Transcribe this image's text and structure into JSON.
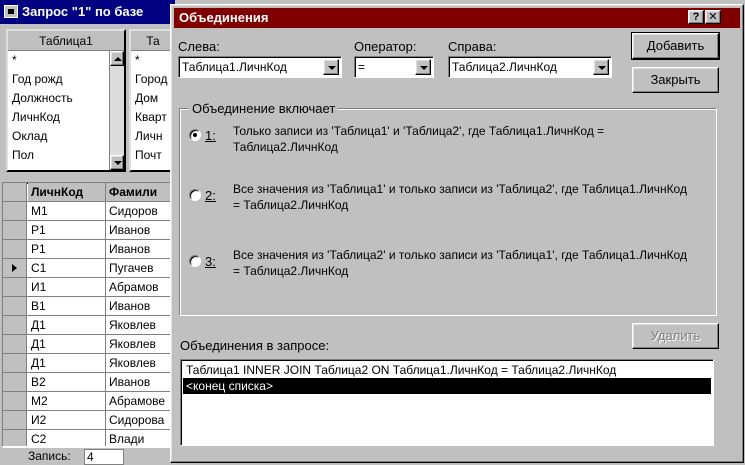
{
  "background_window": {
    "title": "Запрос \"1\" по базе",
    "table1": {
      "title": "Таблица1",
      "fields": [
        "*",
        "Год рожд",
        "Должность",
        "ЛичнКод",
        "Оклад",
        "Пол"
      ]
    },
    "table2": {
      "title": "Та",
      "fields": [
        "*",
        "Город",
        "Дом",
        "Кварт",
        "Личн",
        "Почт"
      ]
    },
    "grid": {
      "columns": [
        "ЛичнКод",
        "Фамили"
      ],
      "rows": [
        [
          "М1",
          "Сидоров"
        ],
        [
          "Р1",
          "Иванов"
        ],
        [
          "Р1",
          "Иванов"
        ],
        [
          "С1",
          "Пугачев"
        ],
        [
          "И1",
          "Абрамов"
        ],
        [
          "В1",
          "Иванов"
        ],
        [
          "Д1",
          "Яковлев"
        ],
        [
          "Д1",
          "Яковлев"
        ],
        [
          "Д1",
          "Яковлев"
        ],
        [
          "В2",
          "Иванов"
        ],
        [
          "М2",
          "Абрамове"
        ],
        [
          "И2",
          "Сидорова"
        ],
        [
          "С2",
          "Влади"
        ]
      ],
      "current_row_index": 3
    },
    "status": {
      "record_label": "Запись:",
      "record_value": "4"
    }
  },
  "dialog": {
    "title": "Объединения",
    "help_button": "?",
    "close_button": "✕",
    "left_label": "Слева:",
    "left_value": "Таблица1.ЛичнКод",
    "operator_label": "Оператор:",
    "operator_value": "=",
    "right_label": "Справа:",
    "right_value": "Таблица2.ЛичнКод",
    "add_button": "Добавить",
    "close_dialog_button": "Закрыть",
    "group_title": "Объединение включает",
    "options": [
      {
        "num": "1:",
        "text": "Только записи из 'Таблица1' и 'Таблица2', где Таблица1.ЛичнКод = Таблица2.ЛичнКод",
        "checked": true
      },
      {
        "num": "2:",
        "text": "Все значения из 'Таблица1' и только записи из 'Таблица2', где Таблица1.ЛичнКод = Таблица2.ЛичнКод",
        "checked": false
      },
      {
        "num": "3:",
        "text": "Все значения из 'Таблица2' и только записи из 'Таблица1', где Таблица1.ЛичнКод = Таблица2.ЛичнКод",
        "checked": false
      }
    ],
    "delete_button": "Удалить",
    "joins_label": "Объединения в запросе:",
    "joins": [
      {
        "text": "Таблица1 INNER JOIN Таблица2 ON Таблица1.ЛичнКод = Таблица2.ЛичнКод",
        "selected": false
      },
      {
        "text": "<конец списка>",
        "selected": true
      }
    ]
  }
}
